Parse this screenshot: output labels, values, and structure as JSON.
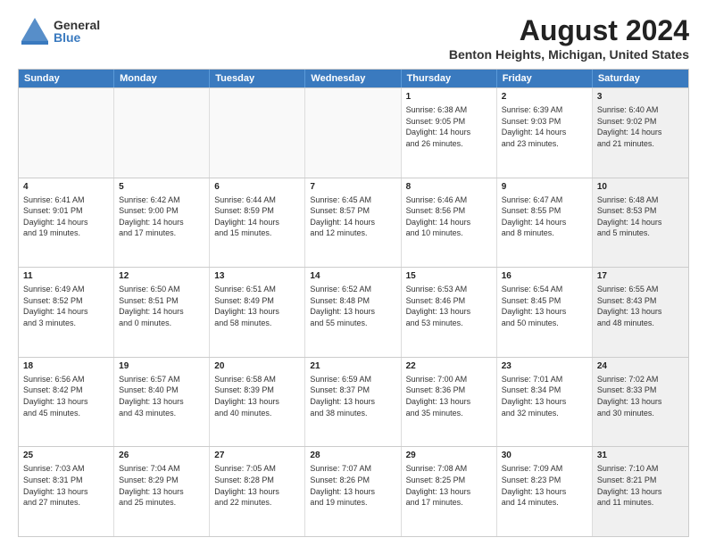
{
  "header": {
    "title": "August 2024",
    "subtitle": "Benton Heights, Michigan, United States",
    "logo_general": "General",
    "logo_blue": "Blue"
  },
  "calendar": {
    "days": [
      "Sunday",
      "Monday",
      "Tuesday",
      "Wednesday",
      "Thursday",
      "Friday",
      "Saturday"
    ],
    "weeks": [
      [
        {
          "day": "",
          "empty": true
        },
        {
          "day": "",
          "empty": true
        },
        {
          "day": "",
          "empty": true
        },
        {
          "day": "",
          "empty": true
        },
        {
          "day": "1",
          "lines": [
            "Sunrise: 6:38 AM",
            "Sunset: 9:05 PM",
            "Daylight: 14 hours",
            "and 26 minutes."
          ]
        },
        {
          "day": "2",
          "lines": [
            "Sunrise: 6:39 AM",
            "Sunset: 9:03 PM",
            "Daylight: 14 hours",
            "and 23 minutes."
          ]
        },
        {
          "day": "3",
          "lines": [
            "Sunrise: 6:40 AM",
            "Sunset: 9:02 PM",
            "Daylight: 14 hours",
            "and 21 minutes."
          ],
          "shaded": true
        }
      ],
      [
        {
          "day": "4",
          "lines": [
            "Sunrise: 6:41 AM",
            "Sunset: 9:01 PM",
            "Daylight: 14 hours",
            "and 19 minutes."
          ]
        },
        {
          "day": "5",
          "lines": [
            "Sunrise: 6:42 AM",
            "Sunset: 9:00 PM",
            "Daylight: 14 hours",
            "and 17 minutes."
          ]
        },
        {
          "day": "6",
          "lines": [
            "Sunrise: 6:44 AM",
            "Sunset: 8:59 PM",
            "Daylight: 14 hours",
            "and 15 minutes."
          ]
        },
        {
          "day": "7",
          "lines": [
            "Sunrise: 6:45 AM",
            "Sunset: 8:57 PM",
            "Daylight: 14 hours",
            "and 12 minutes."
          ]
        },
        {
          "day": "8",
          "lines": [
            "Sunrise: 6:46 AM",
            "Sunset: 8:56 PM",
            "Daylight: 14 hours",
            "and 10 minutes."
          ]
        },
        {
          "day": "9",
          "lines": [
            "Sunrise: 6:47 AM",
            "Sunset: 8:55 PM",
            "Daylight: 14 hours",
            "and 8 minutes."
          ]
        },
        {
          "day": "10",
          "lines": [
            "Sunrise: 6:48 AM",
            "Sunset: 8:53 PM",
            "Daylight: 14 hours",
            "and 5 minutes."
          ],
          "shaded": true
        }
      ],
      [
        {
          "day": "11",
          "lines": [
            "Sunrise: 6:49 AM",
            "Sunset: 8:52 PM",
            "Daylight: 14 hours",
            "and 3 minutes."
          ]
        },
        {
          "day": "12",
          "lines": [
            "Sunrise: 6:50 AM",
            "Sunset: 8:51 PM",
            "Daylight: 14 hours",
            "and 0 minutes."
          ]
        },
        {
          "day": "13",
          "lines": [
            "Sunrise: 6:51 AM",
            "Sunset: 8:49 PM",
            "Daylight: 13 hours",
            "and 58 minutes."
          ]
        },
        {
          "day": "14",
          "lines": [
            "Sunrise: 6:52 AM",
            "Sunset: 8:48 PM",
            "Daylight: 13 hours",
            "and 55 minutes."
          ]
        },
        {
          "day": "15",
          "lines": [
            "Sunrise: 6:53 AM",
            "Sunset: 8:46 PM",
            "Daylight: 13 hours",
            "and 53 minutes."
          ]
        },
        {
          "day": "16",
          "lines": [
            "Sunrise: 6:54 AM",
            "Sunset: 8:45 PM",
            "Daylight: 13 hours",
            "and 50 minutes."
          ]
        },
        {
          "day": "17",
          "lines": [
            "Sunrise: 6:55 AM",
            "Sunset: 8:43 PM",
            "Daylight: 13 hours",
            "and 48 minutes."
          ],
          "shaded": true
        }
      ],
      [
        {
          "day": "18",
          "lines": [
            "Sunrise: 6:56 AM",
            "Sunset: 8:42 PM",
            "Daylight: 13 hours",
            "and 45 minutes."
          ]
        },
        {
          "day": "19",
          "lines": [
            "Sunrise: 6:57 AM",
            "Sunset: 8:40 PM",
            "Daylight: 13 hours",
            "and 43 minutes."
          ]
        },
        {
          "day": "20",
          "lines": [
            "Sunrise: 6:58 AM",
            "Sunset: 8:39 PM",
            "Daylight: 13 hours",
            "and 40 minutes."
          ]
        },
        {
          "day": "21",
          "lines": [
            "Sunrise: 6:59 AM",
            "Sunset: 8:37 PM",
            "Daylight: 13 hours",
            "and 38 minutes."
          ]
        },
        {
          "day": "22",
          "lines": [
            "Sunrise: 7:00 AM",
            "Sunset: 8:36 PM",
            "Daylight: 13 hours",
            "and 35 minutes."
          ]
        },
        {
          "day": "23",
          "lines": [
            "Sunrise: 7:01 AM",
            "Sunset: 8:34 PM",
            "Daylight: 13 hours",
            "and 32 minutes."
          ]
        },
        {
          "day": "24",
          "lines": [
            "Sunrise: 7:02 AM",
            "Sunset: 8:33 PM",
            "Daylight: 13 hours",
            "and 30 minutes."
          ],
          "shaded": true
        }
      ],
      [
        {
          "day": "25",
          "lines": [
            "Sunrise: 7:03 AM",
            "Sunset: 8:31 PM",
            "Daylight: 13 hours",
            "and 27 minutes."
          ]
        },
        {
          "day": "26",
          "lines": [
            "Sunrise: 7:04 AM",
            "Sunset: 8:29 PM",
            "Daylight: 13 hours",
            "and 25 minutes."
          ]
        },
        {
          "day": "27",
          "lines": [
            "Sunrise: 7:05 AM",
            "Sunset: 8:28 PM",
            "Daylight: 13 hours",
            "and 22 minutes."
          ]
        },
        {
          "day": "28",
          "lines": [
            "Sunrise: 7:07 AM",
            "Sunset: 8:26 PM",
            "Daylight: 13 hours",
            "and 19 minutes."
          ]
        },
        {
          "day": "29",
          "lines": [
            "Sunrise: 7:08 AM",
            "Sunset: 8:25 PM",
            "Daylight: 13 hours",
            "and 17 minutes."
          ]
        },
        {
          "day": "30",
          "lines": [
            "Sunrise: 7:09 AM",
            "Sunset: 8:23 PM",
            "Daylight: 13 hours",
            "and 14 minutes."
          ]
        },
        {
          "day": "31",
          "lines": [
            "Sunrise: 7:10 AM",
            "Sunset: 8:21 PM",
            "Daylight: 13 hours",
            "and 11 minutes."
          ],
          "shaded": true
        }
      ]
    ]
  }
}
